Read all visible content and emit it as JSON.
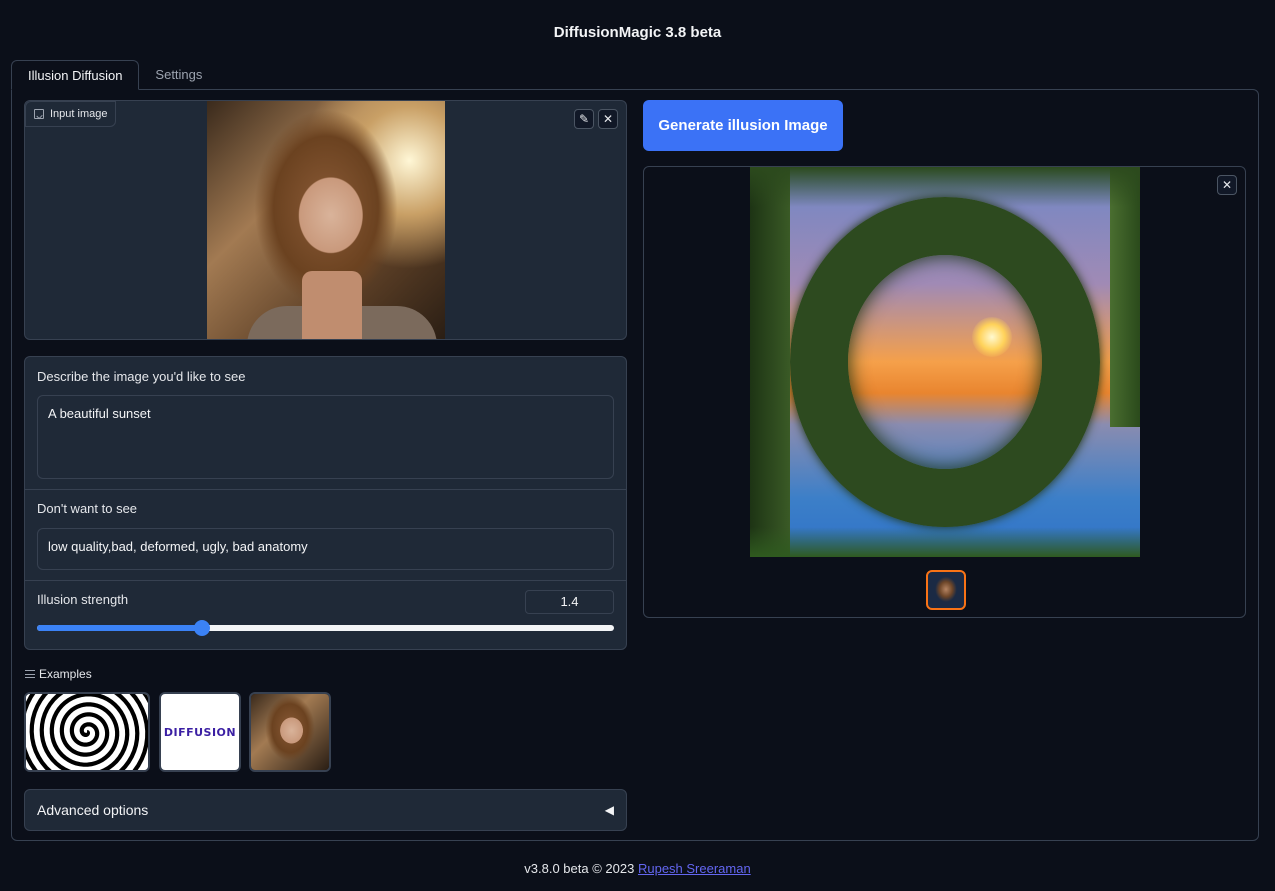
{
  "app": {
    "title": "DiffusionMagic 3.8 beta"
  },
  "tabs": [
    {
      "label": "Illusion Diffusion",
      "active": true
    },
    {
      "label": "Settings",
      "active": false
    }
  ],
  "input_image": {
    "label": "Input image",
    "edit_icon": "pencil-icon",
    "clear_icon": "close-icon"
  },
  "prompt": {
    "label": "Describe the image you'd like to see",
    "value": "A beautiful sunset"
  },
  "negative_prompt": {
    "label": "Don't want to see",
    "value": "low quality,bad, deformed, ugly, bad anatomy"
  },
  "illusion_strength": {
    "label": "Illusion strength",
    "value": "1.4",
    "fraction": 0.286
  },
  "examples": {
    "label": "Examples",
    "items": [
      {
        "kind": "spiral"
      },
      {
        "kind": "text",
        "text": "DIFFUSION"
      },
      {
        "kind": "portrait"
      }
    ]
  },
  "advanced": {
    "label": "Advanced options",
    "arrow": "◀"
  },
  "generate_button": {
    "label": "Generate illusion Image"
  },
  "output": {
    "clear_icon": "close-icon"
  },
  "footer": {
    "text": "v3.8.0 beta © 2023",
    "link_text": "Rupesh Sreeraman"
  },
  "colors": {
    "background": "#0b0f19",
    "panel": "#1f2937",
    "border": "#374151",
    "accent": "#3b82f6",
    "thumb_selected": "#f97316"
  }
}
